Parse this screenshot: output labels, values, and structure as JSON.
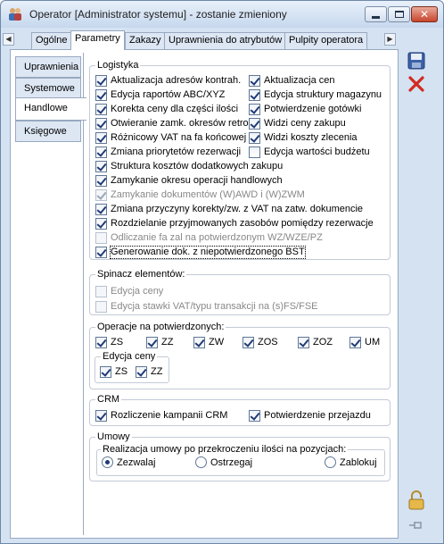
{
  "window": {
    "title": "Operator [Administrator systemu] - zostanie zmieniony"
  },
  "tabs": [
    "Ogólne",
    "Parametry",
    "Zakazy",
    "Uprawnienia do atrybutów",
    "Pulpity operatora"
  ],
  "active_tab": "Parametry",
  "side_tabs": [
    "Uprawnienia",
    "Systemowe",
    "Handlowe",
    "Księgowe"
  ],
  "active_side_tab": "Handlowe",
  "logistyka": {
    "title": "Logistyka",
    "left": [
      {
        "label": "Aktualizacja adresów kontrah.",
        "checked": true
      },
      {
        "label": "Edycja raportów ABC/XYZ",
        "checked": true
      },
      {
        "label": "Korekta ceny dla części ilości",
        "checked": true
      },
      {
        "label": "Otwieranie zamk. okresów retro",
        "checked": true
      },
      {
        "label": "Różnicowy VAT na fa końcowej",
        "checked": true
      },
      {
        "label": "Zmiana priorytetów rezerwacji",
        "checked": true
      }
    ],
    "right": [
      {
        "label": "Aktualizacja cen",
        "checked": true
      },
      {
        "label": "Edycja struktury magazynu",
        "checked": true
      },
      {
        "label": "Potwierdzenie gotówki",
        "checked": true
      },
      {
        "label": "Widzi ceny zakupu",
        "checked": true
      },
      {
        "label": "Widzi koszty zlecenia",
        "checked": true
      },
      {
        "label": "Edycja wartości budżetu",
        "checked": false
      }
    ],
    "full": [
      {
        "label": "Struktura kosztów dodatkowych zakupu",
        "checked": true,
        "disabled": false
      },
      {
        "label": "Zamykanie okresu operacji handlowych",
        "checked": true,
        "disabled": false
      },
      {
        "label": "Zamykanie dokumentów (W)AWD i (W)ZWM",
        "checked": true,
        "disabled": true
      },
      {
        "label": "Zmiana przyczyny korekty/zw. z VAT na zatw. dokumencie",
        "checked": true,
        "disabled": false
      },
      {
        "label": "Rozdzielanie przyjmowanych zasobów pomiędzy rezerwacje",
        "checked": true,
        "disabled": false
      },
      {
        "label": "Odliczanie fa zal na potwierdzonym WZ/WZE/PZ",
        "checked": false,
        "disabled": true
      },
      {
        "label": "Generowanie dok. z niepotwierdzonego BST",
        "checked": true,
        "disabled": false
      }
    ]
  },
  "spinacz": {
    "title": "Spinacz elementów:",
    "items": [
      {
        "label": "Edycja ceny",
        "checked": false
      },
      {
        "label": "Edycja stawki VAT/typu transakcji na (s)FS/FSE",
        "checked": false
      }
    ]
  },
  "operacje": {
    "title": "Operacje na potwierdzonych:",
    "items": [
      "ZS",
      "ZZ",
      "ZW",
      "ZOS",
      "ZOZ",
      "UM"
    ],
    "edycja_title": "Edycja ceny",
    "edycja_items": [
      "ZS",
      "ZZ"
    ]
  },
  "crm": {
    "title": "CRM",
    "items": [
      {
        "label": "Rozliczenie kampanii CRM",
        "checked": true
      },
      {
        "label": "Potwierdzenie przejazdu",
        "checked": true
      }
    ]
  },
  "umowy": {
    "title": "Umowy",
    "subtitle": "Realizacja umowy po przekroczeniu ilości na pozycjach:",
    "options": [
      "Zezwalaj",
      "Ostrzegaj",
      "Zablokuj"
    ],
    "selected": "Zezwalaj"
  }
}
